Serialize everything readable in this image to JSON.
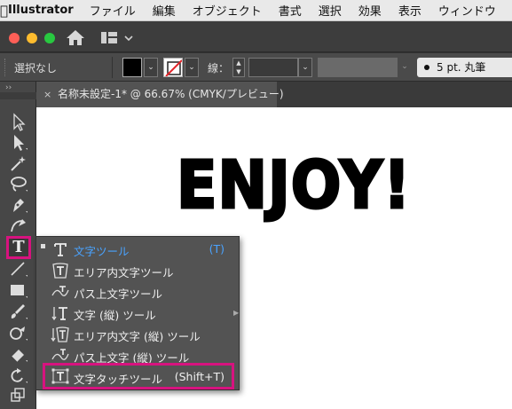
{
  "menubar": {
    "app_name": "Illustrator",
    "items": [
      "ファイル",
      "編集",
      "オブジェクト",
      "書式",
      "選択",
      "効果",
      "表示",
      "ウィンドウ"
    ]
  },
  "controlbar": {
    "selection_status": "選択なし",
    "stroke_label": "線：",
    "brush_label": "5 pt. 丸筆"
  },
  "document": {
    "tab_title": "名称未設定-1* @ 66.67% (CMYK/プレビュー)",
    "close_glyph": "×",
    "canvas_text": "ENJOY!"
  },
  "tools": {
    "type_tool_glyph": "T",
    "collapse_glyph": "››"
  },
  "flyout": {
    "items": [
      {
        "label": "文字ツール",
        "shortcut": "(T)",
        "active": true
      },
      {
        "label": "エリア内文字ツール",
        "shortcut": ""
      },
      {
        "label": "パス上文字ツール",
        "shortcut": ""
      },
      {
        "label": "文字 (縦) ツール",
        "shortcut": ""
      },
      {
        "label": "エリア内文字 (縦) ツール",
        "shortcut": ""
      },
      {
        "label": "パス上文字 (縦) ツール",
        "shortcut": ""
      },
      {
        "label": "文字タッチツール",
        "shortcut": "(Shift+T)",
        "highlighted": true
      }
    ]
  },
  "colors": {
    "highlight_frame": "#d7137f",
    "active_item": "#4aa3ff",
    "menu_bg": "#535353"
  }
}
